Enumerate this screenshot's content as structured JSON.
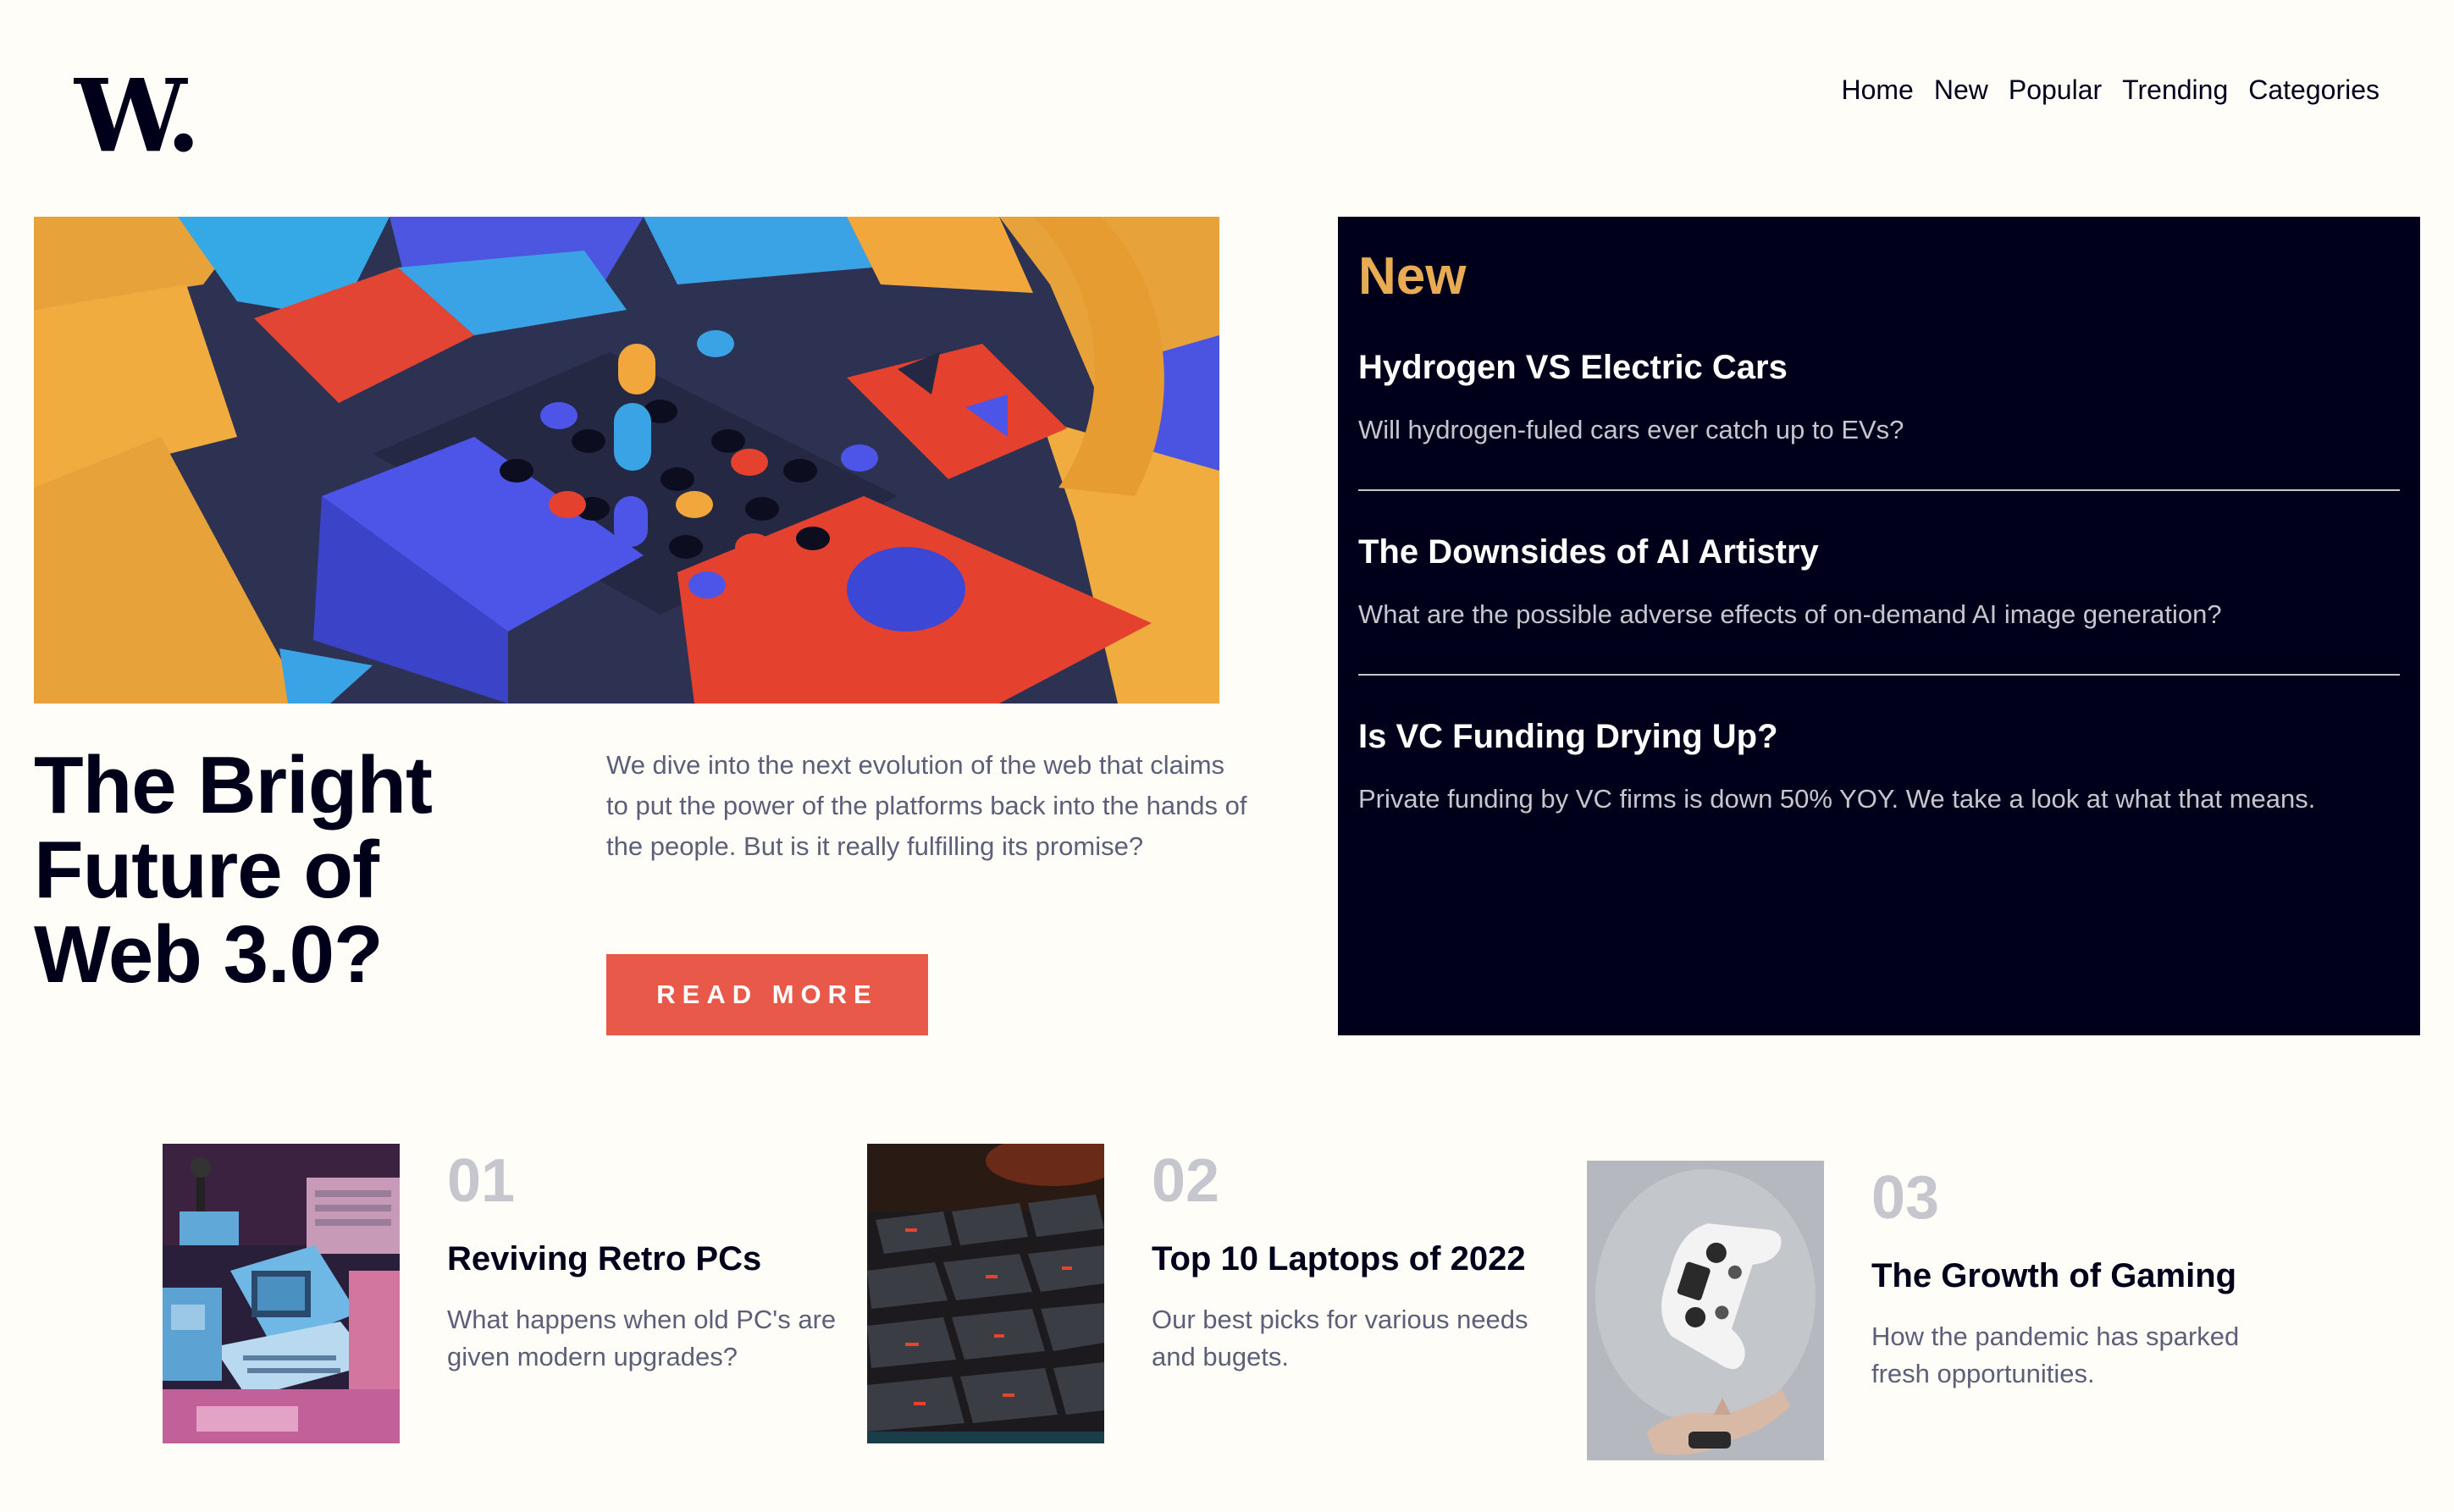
{
  "brand": {
    "logo_text": "W",
    "logo_dot": "."
  },
  "nav": {
    "items": [
      "Home",
      "New",
      "Popular",
      "Trending",
      "Categories"
    ]
  },
  "hero": {
    "title": "The Bright Future of Web 3.0?",
    "description": "We dive into the next evolution of the web that claims to put the power of the platforms back into the hands of the people. But is it really fulfilling its promise?",
    "button_label": "READ MORE"
  },
  "new_panel": {
    "heading": "New",
    "items": [
      {
        "title": "Hydrogen VS Electric Cars",
        "description": "Will hydrogen-fuled cars ever catch up to EVs?"
      },
      {
        "title": "The Downsides of AI Artistry",
        "description": "What are the possible adverse effects of on-demand AI image generation?"
      },
      {
        "title": "Is VC Funding Drying Up?",
        "description": "Private funding by VC firms is down 50% YOY. We take a look at what that means."
      }
    ]
  },
  "cards": [
    {
      "number": "01",
      "title": "Reviving Retro PCs",
      "description": "What happens when old PC's are given modern upgrades?"
    },
    {
      "number": "02",
      "title": "Top 10 Laptops of 2022",
      "description": "Our best picks for various needs and bugets."
    },
    {
      "number": "03",
      "title": "The Growth of Gaming",
      "description": "How the pandemic has sparked fresh opportunities."
    }
  ],
  "colors": {
    "background": "#fffdf8",
    "dark_blue": "#00001a",
    "accent_red": "#e9594a",
    "accent_orange": "#e9ab53",
    "grayish_blue": "#5d5f79",
    "light_gray": "#c5c6ce"
  }
}
